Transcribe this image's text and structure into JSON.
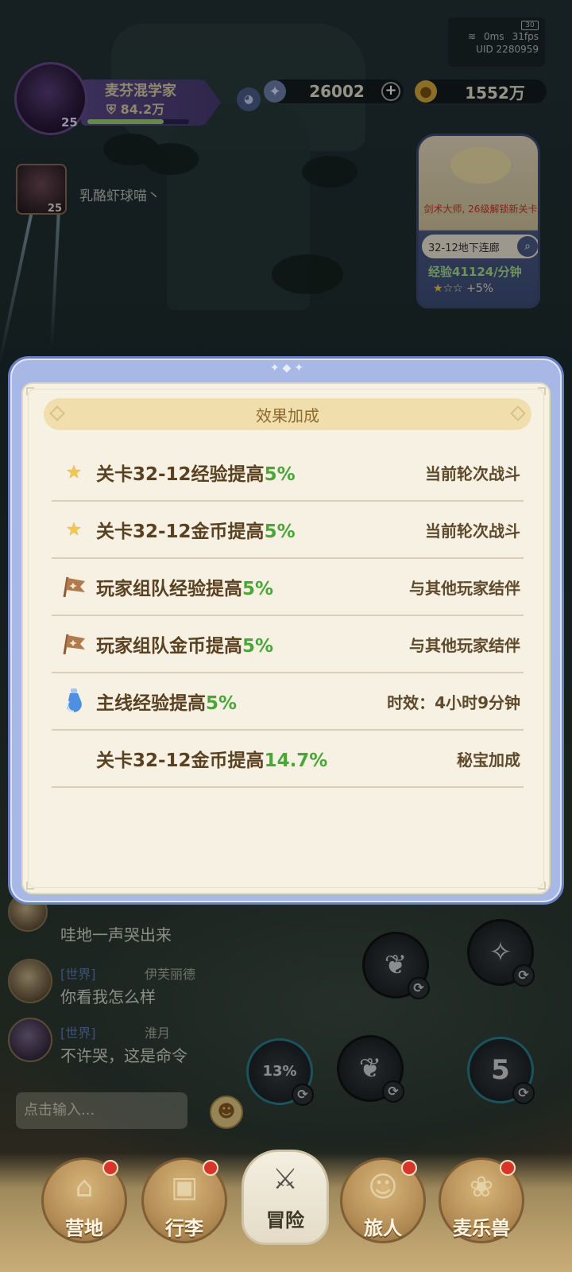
{
  "status": {
    "ping": "0ms",
    "fps": "31fps",
    "uid": "UID 2280959",
    "battery": "30"
  },
  "player": {
    "name": "麦芬混学家",
    "power": "84.2万",
    "level": "25",
    "xp_fraction": 0.75
  },
  "resources": {
    "gems": "26002",
    "gold": "1552万",
    "plus": "+"
  },
  "companion": {
    "name": "乳酪虾球喵丶",
    "level": "25"
  },
  "stage": {
    "unlock_text": "剑术大师, 26级解锁新关卡",
    "name": "32-12地下连廊",
    "exp_label": "经验",
    "exp_value": "41124",
    "exp_unit": "/分钟",
    "bonus": "+5%"
  },
  "modal": {
    "title": "效果加成",
    "effects": [
      {
        "icon": "star-icon",
        "text": "关卡32-12经验提高",
        "pct": "5%",
        "note": "当前轮次战斗"
      },
      {
        "icon": "star-icon",
        "text": "关卡32-12金币提高",
        "pct": "5%",
        "note": "当前轮次战斗"
      },
      {
        "icon": "flag-icon",
        "text": "玩家组队经验提高",
        "pct": "5%",
        "note": "与其他玩家结伴"
      },
      {
        "icon": "flag-icon",
        "text": "玩家组队金币提高",
        "pct": "5%",
        "note": "与其他玩家结伴"
      },
      {
        "icon": "potion-icon",
        "text": "主线经验提高",
        "pct": "5%",
        "note": "时效：4小时9分钟"
      },
      {
        "icon": "",
        "text": "关卡32-12金币提高",
        "pct": "14.7%",
        "note": "秘宝加成"
      }
    ]
  },
  "chat": {
    "messages": [
      {
        "channel": "",
        "sender": "",
        "text": "哇地一声哭出来"
      },
      {
        "channel": "[世界]",
        "sender": "伊芙丽德",
        "text": "你看我怎么样"
      },
      {
        "channel": "[世界]",
        "sender": "淮月",
        "text": "不许哭，这是命令"
      }
    ],
    "input_placeholder": "点击输入..."
  },
  "skills": [
    {
      "label": "",
      "cycle": "⟳"
    },
    {
      "label": "",
      "cycle": "⟳"
    },
    {
      "label": "13%",
      "cycle": "⟳"
    },
    {
      "label": "",
      "cycle": "⟳"
    },
    {
      "label": "5",
      "cycle": "⟳"
    }
  ],
  "nav": {
    "items": [
      {
        "label": "营地",
        "glyph": "⌂"
      },
      {
        "label": "行李",
        "glyph": "▣"
      },
      {
        "label": "冒险",
        "glyph": "⚔"
      },
      {
        "label": "旅人",
        "glyph": "☺"
      },
      {
        "label": "麦乐兽",
        "glyph": "❀"
      }
    ],
    "active_index": 2
  },
  "colors": {
    "accent_green": "#4aa637",
    "modal_frame": "#a8b8e6",
    "notification_red": "#d8352a"
  }
}
